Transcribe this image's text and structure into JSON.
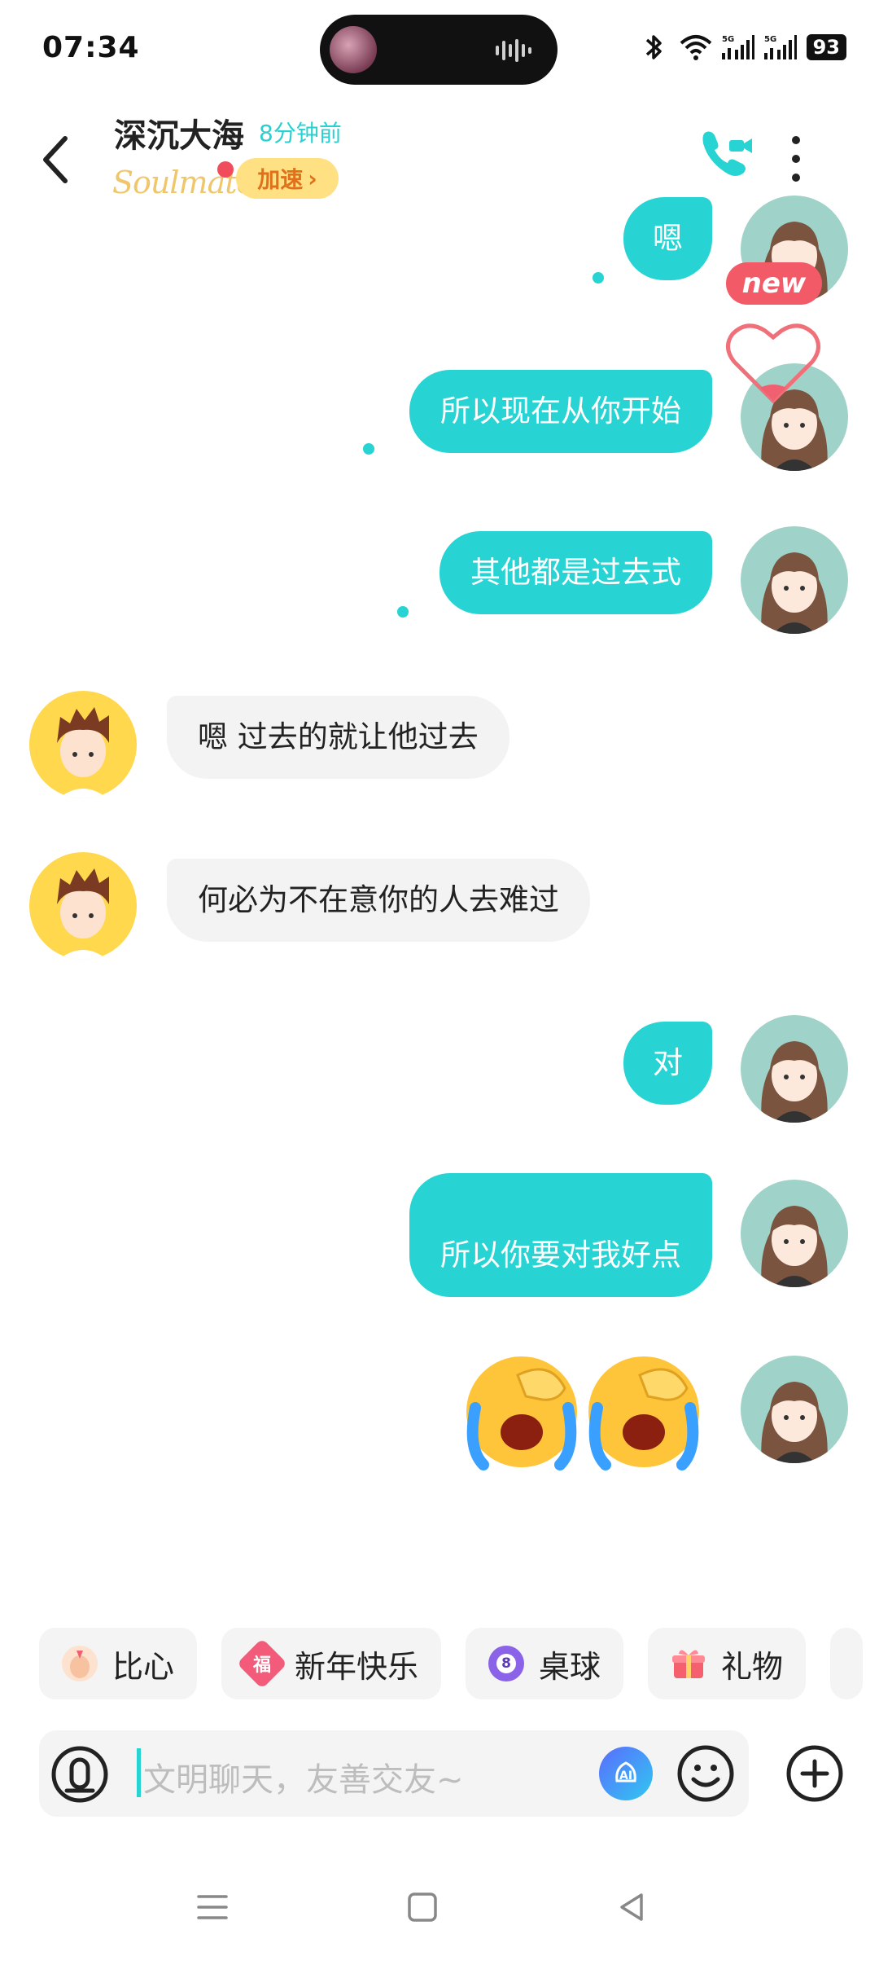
{
  "status_bar": {
    "time": "07:34",
    "battery": "93",
    "network_1": "5G",
    "network_2": "5G",
    "icons": [
      "bluetooth-icon",
      "wifi-icon",
      "signal-icon",
      "signal-icon",
      "battery-icon"
    ]
  },
  "header": {
    "name": "深沉大海",
    "last_seen": "8分钟前",
    "badge_logo": "Soulmate",
    "speed_label": "加速",
    "speed_arrow": "›"
  },
  "colors": {
    "accent": "#27d4d3",
    "other_bubble": "#f3f3f3",
    "badge_red": "#f35a68",
    "speed_bg": "#ffe082"
  },
  "messages": [
    {
      "from": "me",
      "text": "嗯"
    },
    {
      "from": "me",
      "text": "所以现在从你开始"
    },
    {
      "from": "me",
      "text": "其他都是过去式"
    },
    {
      "from": "them",
      "text": "嗯   过去的就让他过去"
    },
    {
      "from": "them",
      "text": "何必为不在意你的人去难过"
    },
    {
      "from": "me",
      "text": "对"
    },
    {
      "from": "me",
      "text": "所以你要对我好点"
    },
    {
      "from": "me",
      "type": "emoji",
      "emoji": "loudly-crying-face x2"
    }
  ],
  "new_badge": "new",
  "quick_actions": [
    {
      "label": "比心",
      "icon": "finger-heart-icon"
    },
    {
      "label": "新年快乐",
      "icon": "fu-icon"
    },
    {
      "label": "桌球",
      "icon": "billiard-ball-icon"
    },
    {
      "label": "礼物",
      "icon": "gift-icon"
    }
  ],
  "input": {
    "placeholder": "文明聊天，友善交友~"
  },
  "nav": [
    "menu-icon",
    "home-icon",
    "back-icon"
  ]
}
